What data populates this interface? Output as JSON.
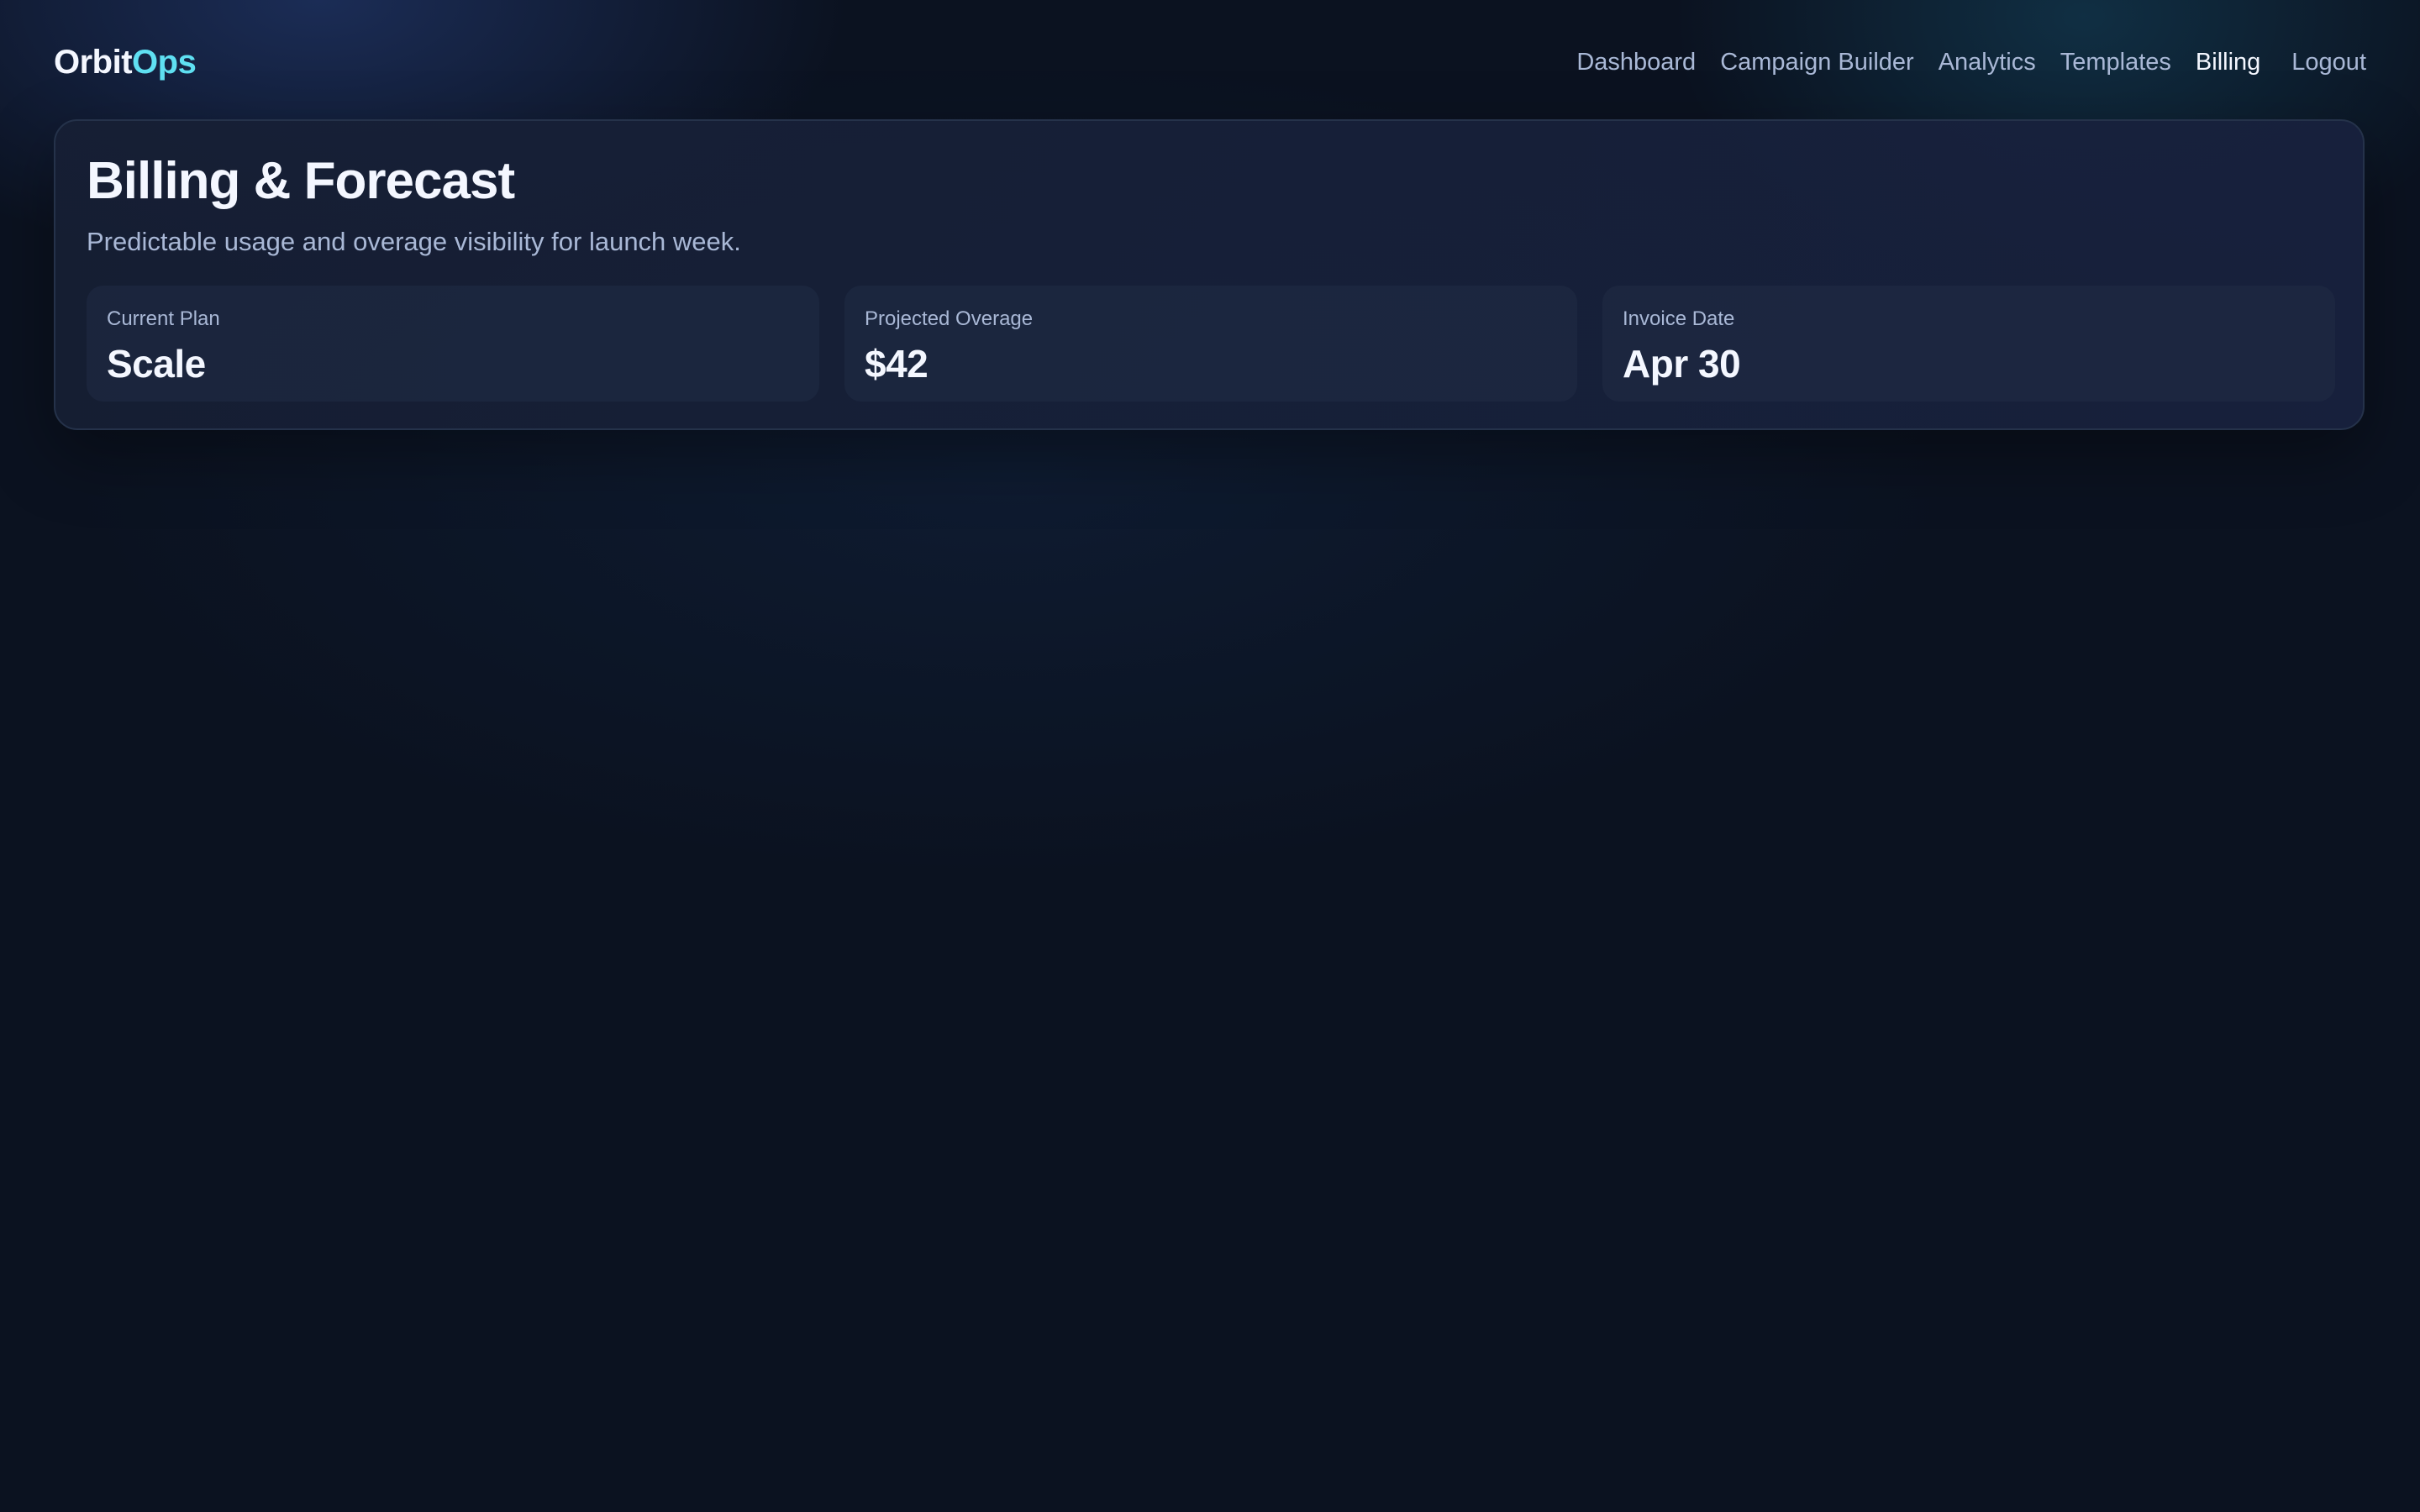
{
  "brand": {
    "name_part1": "Orbit",
    "name_part2": "Ops",
    "accent_color": "#5fe0f2"
  },
  "nav": {
    "items": [
      {
        "label": "Dashboard",
        "active": false
      },
      {
        "label": "Campaign Builder",
        "active": false
      },
      {
        "label": "Analytics",
        "active": false
      },
      {
        "label": "Templates",
        "active": false
      },
      {
        "label": "Billing",
        "active": true
      }
    ],
    "logout_label": "Logout"
  },
  "main": {
    "title": "Billing & Forecast",
    "subtitle": "Predictable usage and overage visibility for launch week.",
    "stats": [
      {
        "label": "Current Plan",
        "value": "Scale"
      },
      {
        "label": "Projected Overage",
        "value": "$42"
      },
      {
        "label": "Invoice Date",
        "value": "Apr 30"
      }
    ]
  },
  "colors": {
    "background": "#0b1220",
    "text_primary": "#f4f7ff",
    "text_secondary": "#a9b8d6"
  }
}
